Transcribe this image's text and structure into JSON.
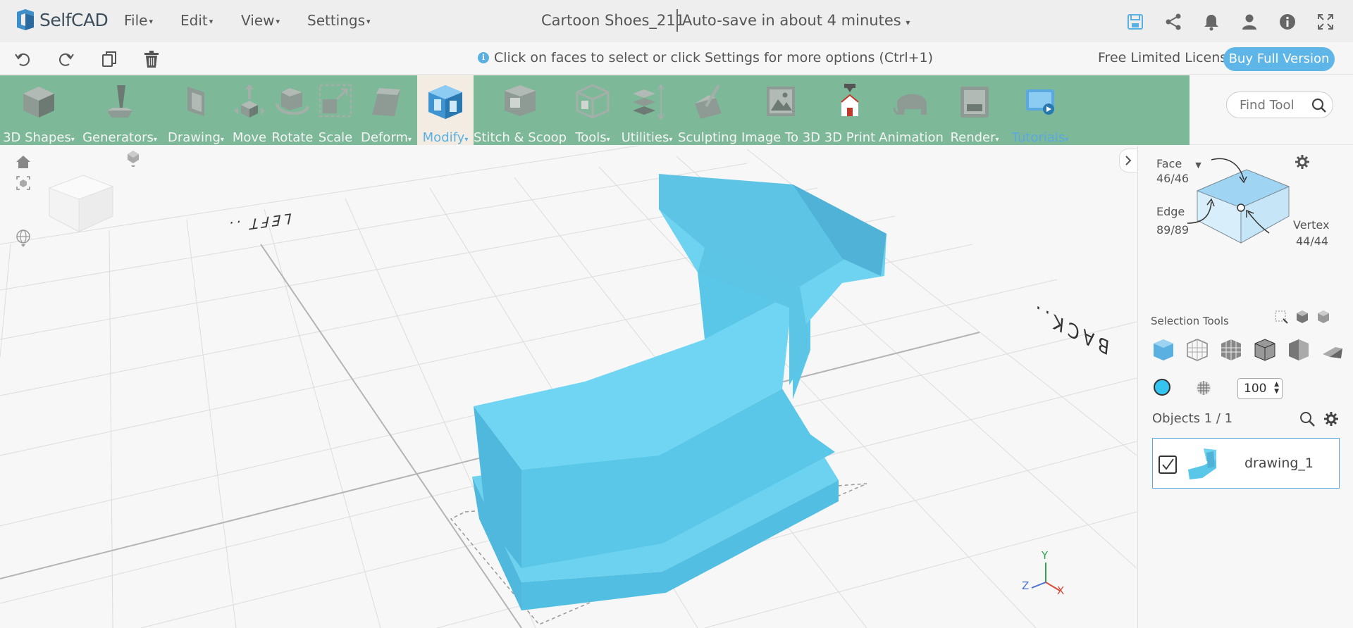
{
  "app": {
    "name": "SelfCAD"
  },
  "menu": {
    "file": "File",
    "edit": "Edit",
    "view": "View",
    "settings": "Settings"
  },
  "document": {
    "title": "Cartoon Shoes_211",
    "autosave": "Auto-save in about 4 minutes"
  },
  "hint": "Click on faces to select or click Settings for more options (Ctrl+1)",
  "license": {
    "text": "Free Limited License",
    "buy_label": "Buy Full Version"
  },
  "toolbar": {
    "items": [
      {
        "label": "3D Shapes",
        "dropdown": true
      },
      {
        "label": "Generators",
        "dropdown": true
      },
      {
        "label": "Drawing",
        "dropdown": true
      },
      {
        "label": "Move",
        "dropdown": false
      },
      {
        "label": "Rotate",
        "dropdown": false
      },
      {
        "label": "Scale",
        "dropdown": false
      },
      {
        "label": "Deform",
        "dropdown": true
      },
      {
        "label": "Modify",
        "dropdown": true,
        "active": true
      },
      {
        "label": "Stitch & Scoop",
        "dropdown": false
      },
      {
        "label": "Tools",
        "dropdown": true
      },
      {
        "label": "Utilities",
        "dropdown": true
      },
      {
        "label": "Sculpting",
        "dropdown": false
      },
      {
        "label": "Image To 3D",
        "dropdown": false
      },
      {
        "label": "3D Print",
        "dropdown": false
      },
      {
        "label": "Animation",
        "dropdown": false
      },
      {
        "label": "Render",
        "dropdown": true
      },
      {
        "label": "Tutorials",
        "dropdown": true
      }
    ],
    "find_tool_placeholder": "Find Tool"
  },
  "viewport": {
    "label_left": "LEFT ..",
    "label_back": "BACK..",
    "axes": {
      "x": "X",
      "y": "Y",
      "z": "Z"
    }
  },
  "panel": {
    "face_label": "Face",
    "face_count": "46/46",
    "edge_label": "Edge",
    "edge_count": "89/89",
    "vertex_label": "Vertex",
    "vertex_count": "44/44",
    "selection_tools_label": "Selection Tools",
    "opacity": "100",
    "objects_label": "Objects 1 / 1",
    "objects": [
      {
        "name": "drawing_1",
        "visible": true
      }
    ]
  },
  "colors": {
    "accent": "#5eb5e8",
    "toolbar_bg": "#7db898",
    "model": "#5ecbea",
    "active_tool_bg": "#f3ece2"
  }
}
